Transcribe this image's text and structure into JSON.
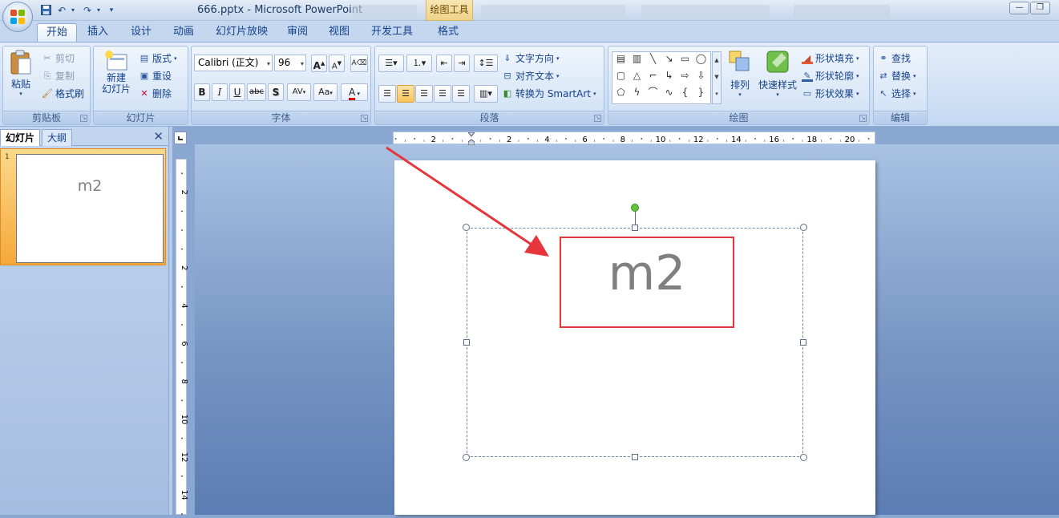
{
  "window": {
    "title": "666.pptx - Microsoft PowerPoint",
    "contextual_tab": "绘图工具",
    "minimize": "—",
    "restore": "❐"
  },
  "tabs": [
    "开始",
    "插入",
    "设计",
    "动画",
    "幻灯片放映",
    "审阅",
    "视图",
    "开发工具",
    "格式"
  ],
  "active_tab": "开始",
  "clipboard": {
    "label": "剪贴板",
    "paste": "粘贴",
    "cut": "剪切",
    "copy": "复制",
    "format_painter": "格式刷"
  },
  "slides_group": {
    "label": "幻灯片",
    "new_slide": "新建\n幻灯片",
    "new_slide_l1": "新建",
    "new_slide_l2": "幻灯片",
    "layout": "版式",
    "reset": "重设",
    "delete": "删除"
  },
  "font": {
    "label": "字体",
    "family": "Calibri (正文)",
    "size": "96",
    "grow": "A",
    "shrink": "A",
    "bold": "B",
    "italic": "I",
    "underline": "U",
    "strike": "abc",
    "shadow": "S",
    "spacing": "AV",
    "case": "Aa",
    "color": "A",
    "font_color_accent": "#e30000"
  },
  "paragraph": {
    "label": "段落",
    "text_direction": "文字方向",
    "align_text": "对齐文本",
    "convert_smartart": "转换为 SmartArt"
  },
  "drawing": {
    "label": "绘图",
    "arrange": "排列",
    "quick_styles": "快速样式",
    "shape_fill": "形状填充",
    "shape_outline": "形状轮廓",
    "shape_effects": "形状效果"
  },
  "editing": {
    "label": "编辑",
    "find": "查找",
    "replace": "替换",
    "select": "选择"
  },
  "pane": {
    "tab_slides": "幻灯片",
    "tab_outline": "大纲",
    "close": "✕",
    "thumb_number": "1",
    "thumb_text": "m2"
  },
  "rulers": {
    "h_ticks": [
      "2",
      "2",
      "4",
      "6",
      "8",
      "10",
      "12",
      "14",
      "16",
      "18",
      "20"
    ],
    "v_ticks": [
      "2",
      "2",
      "4",
      "6",
      "8",
      "10",
      "12",
      "14"
    ]
  },
  "slide": {
    "text": "m2"
  },
  "annotation": {
    "arrow_color": "#e5363c",
    "box_color": "#e5363c"
  }
}
